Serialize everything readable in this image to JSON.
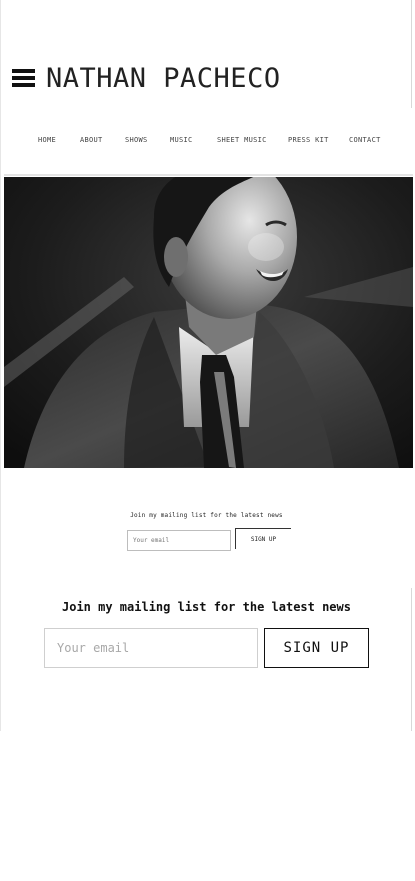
{
  "site": {
    "title": "NATHAN PACHECO"
  },
  "icons": {
    "menu": "hamburger-menu-icon"
  },
  "nav": {
    "items": [
      {
        "label": "HOME"
      },
      {
        "label": "ABOUT"
      },
      {
        "label": "SHOWS"
      },
      {
        "label": "MUSIC"
      },
      {
        "label": "SHEET MUSIC"
      },
      {
        "label": "PRESS KIT"
      },
      {
        "label": "CONTACT"
      }
    ]
  },
  "hero": {
    "image": "grayscale-portrait-of-man-in-suit-and-tie"
  },
  "signup_small": {
    "heading": "Join my mailing list for the latest news",
    "placeholder": "Your email",
    "button": "SIGN UP"
  },
  "signup": {
    "heading": "Join my mailing list for the latest news",
    "placeholder": "Your email",
    "button": "SIGN UP"
  },
  "colors": {
    "text": "#111111",
    "border": "#cfcfcf",
    "background": "#ffffff"
  }
}
